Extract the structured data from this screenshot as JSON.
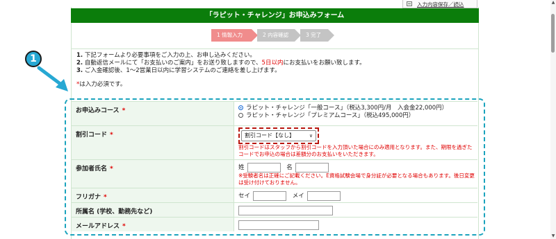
{
  "top_link": {
    "label": "入力内容保存／読込",
    "icon": "save-icon"
  },
  "form_title": "「ラピット・チャレンジ」お申込みフォーム",
  "steps": [
    "1 情報入力",
    "2 内容確認",
    "3 完了"
  ],
  "intro": {
    "line1_num": "1.",
    "line1_text": " 下記フォームより必要事項をご入力の上、お申し込みください。",
    "line2_num": "2.",
    "line2_text_a": " 自動返信メールにて「お支払いのご案内」をお送り致しますので、",
    "line2_highlight": "5日以内",
    "line2_text_b": "にお支払いをお願い致します。",
    "line3_num": "3.",
    "line3_text": " ご入金確認後、1〜2営業日以内に学習システムのご連絡を差し上げます。",
    "required_star": "*",
    "required_text": "は入力必須です。"
  },
  "annotation": {
    "number": "1"
  },
  "fields": {
    "course": {
      "label": "お申込みコース",
      "star": "*",
      "option1": "ラピット・チャレンジ「一般コース」（税込3,300円/月　入会金22,000円）",
      "option2": "ラピット・チャレンジ「プレミアムコース」（税込495,000円）"
    },
    "discount": {
      "label": "割引コード",
      "star": "*",
      "selected": "割引コード【なし】",
      "note": "割引コードはスタッフから割引コードを入力頂いた場合にのみ適用となります。また、期限を過ぎたコードでお申込の場合は差額分のお支払いをいただきます。"
    },
    "name": {
      "label": "参加者氏名",
      "star": "*",
      "sei": "姓",
      "mei": "名",
      "note": "※受験者名は正確にご記載ください。E資格試験会場で身分証が必要となる場合もあります。後日変更は受け付けておりません。"
    },
    "furigana": {
      "label": "フリガナ",
      "star": "*",
      "sei": "セイ",
      "mei": "メイ"
    },
    "affiliation": {
      "label": "所属名 (学校、勤務先など)"
    },
    "email": {
      "label": "メールアドレス",
      "star": "*"
    }
  },
  "colors": {
    "title_bg": "#0b7d0b",
    "step_active": "#f08c8c",
    "step_inactive": "#c4c4c4",
    "required": "#e00000",
    "dashed_box": "#1aa3bd",
    "select_highlight": "#b8160e"
  }
}
